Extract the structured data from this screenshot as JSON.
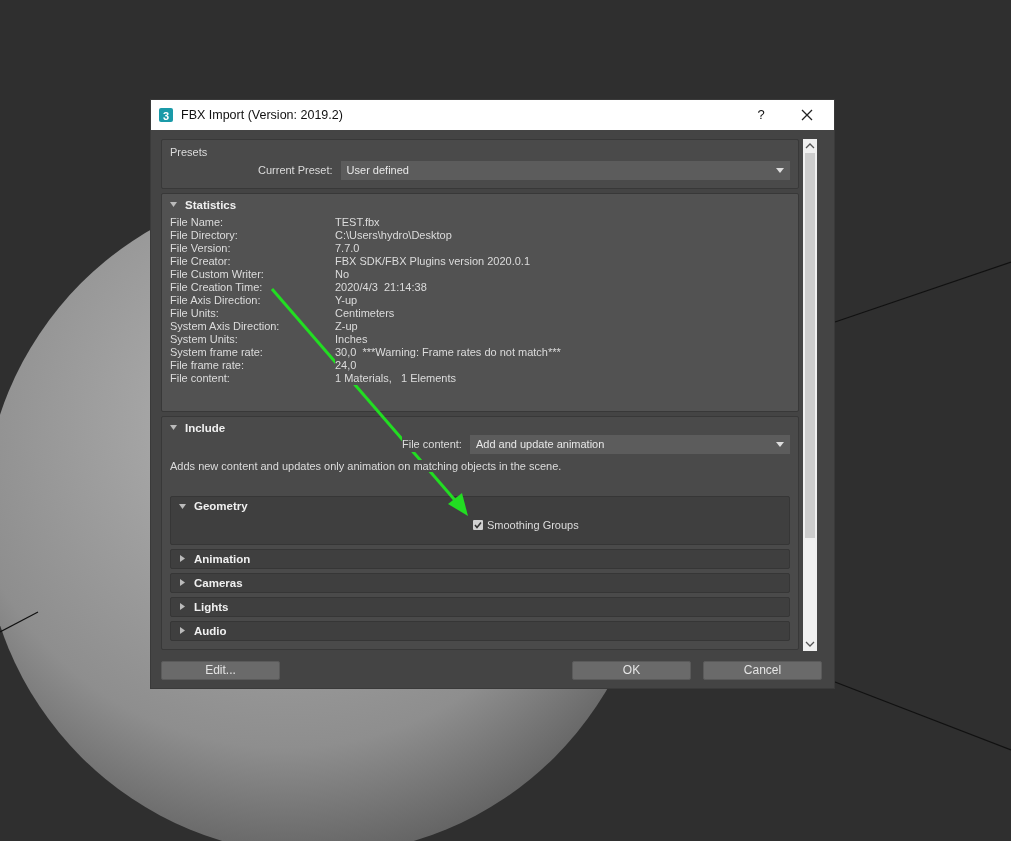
{
  "window": {
    "icon_label": "3",
    "title": "FBX Import (Version: 2019.2)",
    "help": "?"
  },
  "presets": {
    "title": "Presets",
    "label": "Current Preset:",
    "value": "User defined"
  },
  "statistics": {
    "title": "Statistics",
    "expanded": true,
    "rows": [
      {
        "label": "File Name:",
        "value": "TEST.fbx"
      },
      {
        "label": "File Directory:",
        "value": "C:\\Users\\hydro\\Desktop"
      },
      {
        "label": "File Version:",
        "value": "7.7.0"
      },
      {
        "label": "File Creator:",
        "value": "FBX SDK/FBX Plugins version 2020.0.1"
      },
      {
        "label": "File Custom Writer:",
        "value": "No"
      },
      {
        "label": "File Creation Time:",
        "value": "2020/4/3  21:14:38"
      },
      {
        "label": "File Axis Direction:",
        "value": "Y-up"
      },
      {
        "label": "File Units:",
        "value": "Centimeters"
      },
      {
        "label": "System Axis Direction:",
        "value": "Z-up"
      },
      {
        "label": "System Units:",
        "value": "Inches"
      },
      {
        "label": "System frame rate:",
        "value": "30,0  ***Warning: Frame rates do not match***"
      },
      {
        "label": "File frame rate:",
        "value": "24,0"
      },
      {
        "label": "File content:",
        "value": "1 Materials,   1 Elements"
      }
    ]
  },
  "include": {
    "title": "Include",
    "expanded": true,
    "file_content_label": "File content:",
    "file_content_value": "Add and update animation",
    "description": "Adds new content and updates only animation on matching objects in the scene.",
    "sections": [
      {
        "title": "Geometry",
        "expanded": true,
        "options": [
          {
            "label": "Smoothing Groups",
            "checked": true
          }
        ]
      },
      {
        "title": "Animation",
        "expanded": false
      },
      {
        "title": "Cameras",
        "expanded": false
      },
      {
        "title": "Lights",
        "expanded": false
      },
      {
        "title": "Audio",
        "expanded": false
      }
    ]
  },
  "buttons": [
    {
      "label": "Edit..."
    },
    {
      "label": "OK"
    },
    {
      "label": "Cancel"
    }
  ]
}
